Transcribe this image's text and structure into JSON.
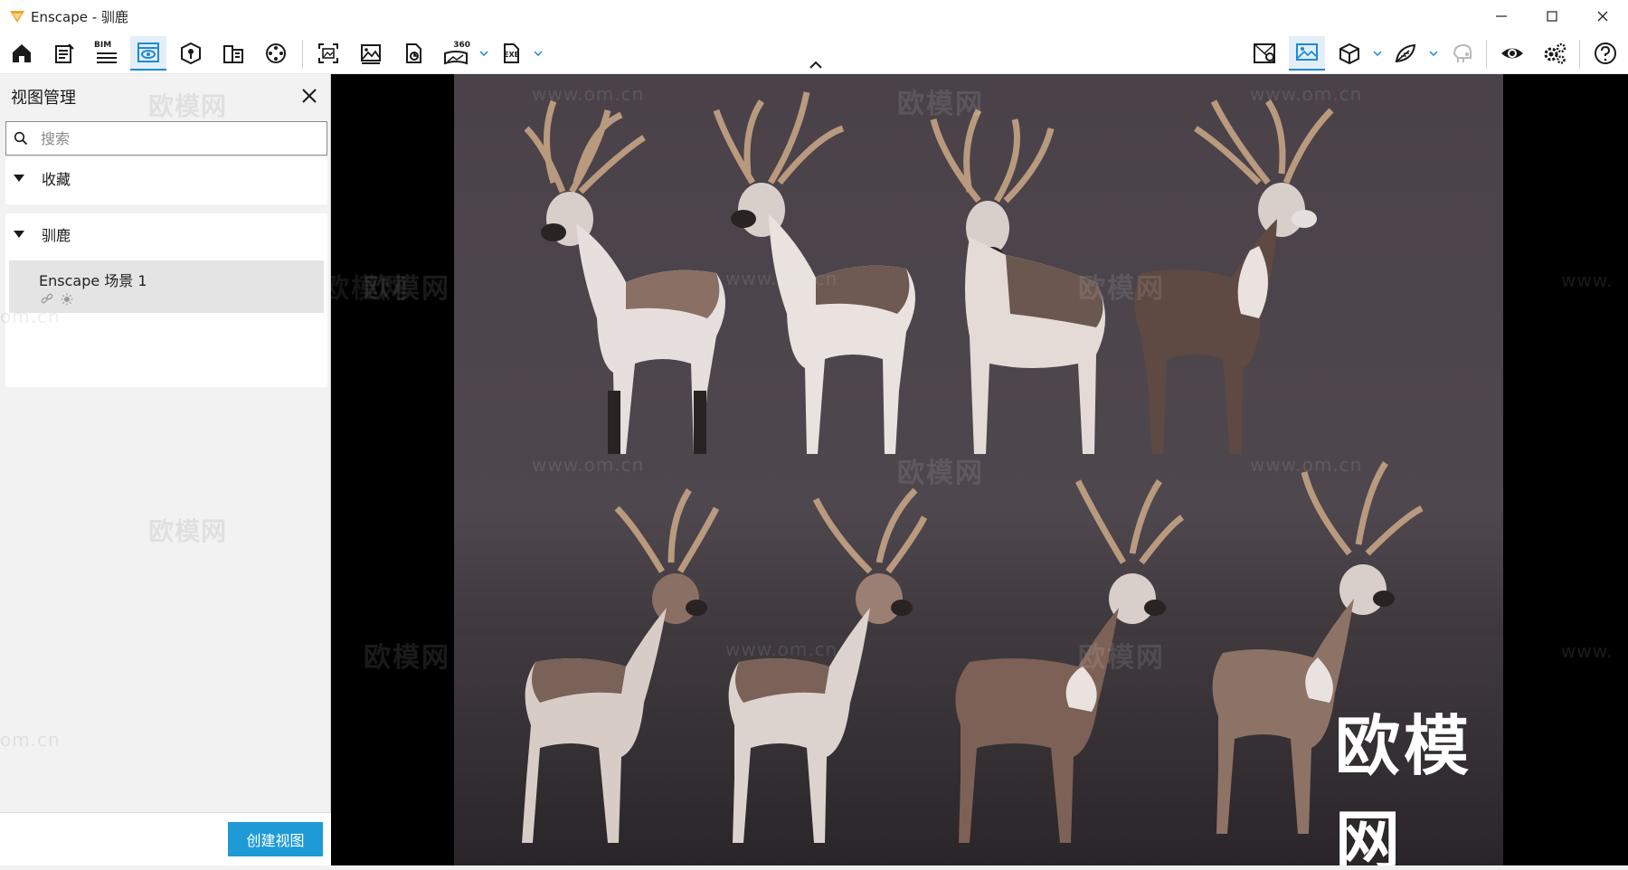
{
  "window": {
    "title": "Enscape - 驯鹿",
    "brand_color": "#f0a32a"
  },
  "toolbar": {
    "bim_label": "BIM",
    "pano_label": "360",
    "exe_label": "EXE",
    "active_tool": "view-management",
    "accent_color": "#1a8ad8"
  },
  "panel": {
    "title": "视图管理",
    "search_placeholder": "搜索",
    "sections": [
      {
        "label": "收藏",
        "expanded": true
      },
      {
        "label": "驯鹿",
        "expanded": true
      }
    ],
    "views": [
      {
        "name": "Enscape 场景 1"
      }
    ],
    "create_button": "创建视图"
  },
  "viewport": {
    "watermark_text": "欧模网",
    "watermark_url": "www.om.cn",
    "watermark_url_partial": "om.cn",
    "watermark_url_cut": "www.",
    "overlay_logo_text": "欧模网"
  }
}
